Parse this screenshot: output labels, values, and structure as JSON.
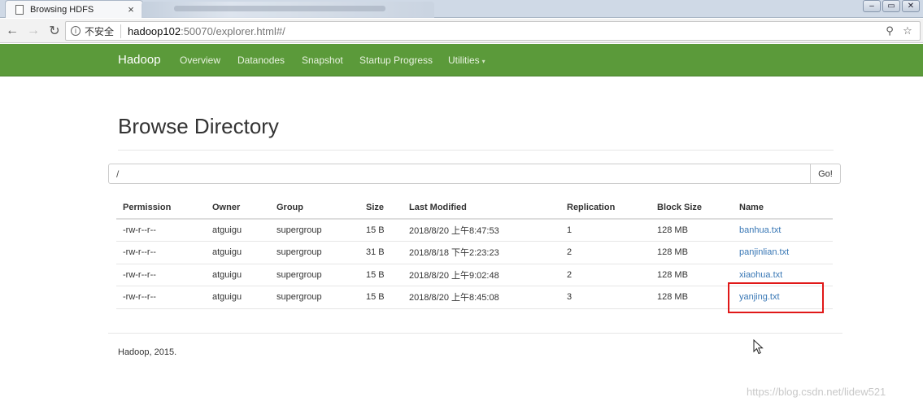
{
  "browser": {
    "tab_title": "Browsing HDFS",
    "tab_close": "×",
    "insecure_label": "不安全",
    "url_host": "hadoop102",
    "url_rest": ":50070/explorer.html#/",
    "window_controls": [
      "–",
      "▭",
      "✕"
    ]
  },
  "navbar": {
    "brand": "Hadoop",
    "items": [
      "Overview",
      "Datanodes",
      "Snapshot",
      "Startup Progress",
      "Utilities"
    ],
    "caret": "▾"
  },
  "page": {
    "title": "Browse Directory",
    "path_value": "/",
    "go_label": "Go!"
  },
  "table": {
    "headers": [
      "Permission",
      "Owner",
      "Group",
      "Size",
      "Last Modified",
      "Replication",
      "Block Size",
      "Name"
    ],
    "rows": [
      [
        "-rw-r--r--",
        "atguigu",
        "supergroup",
        "15 B",
        "2018/8/20 上午8:47:53",
        "1",
        "128 MB",
        "banhua.txt"
      ],
      [
        "-rw-r--r--",
        "atguigu",
        "supergroup",
        "31 B",
        "2018/8/18 下午2:23:23",
        "2",
        "128 MB",
        "panjinlian.txt"
      ],
      [
        "-rw-r--r--",
        "atguigu",
        "supergroup",
        "15 B",
        "2018/8/20 上午9:02:48",
        "2",
        "128 MB",
        "xiaohua.txt"
      ],
      [
        "-rw-r--r--",
        "atguigu",
        "supergroup",
        "15 B",
        "2018/8/20 上午8:45:08",
        "3",
        "128 MB",
        "yanjing.txt"
      ]
    ]
  },
  "footer": "Hadoop, 2015.",
  "watermark": "https://blog.csdn.net/lidew521",
  "colors": {
    "navbar": "#5b9a3a",
    "link": "#3877b5",
    "highlight": "#e01818"
  }
}
